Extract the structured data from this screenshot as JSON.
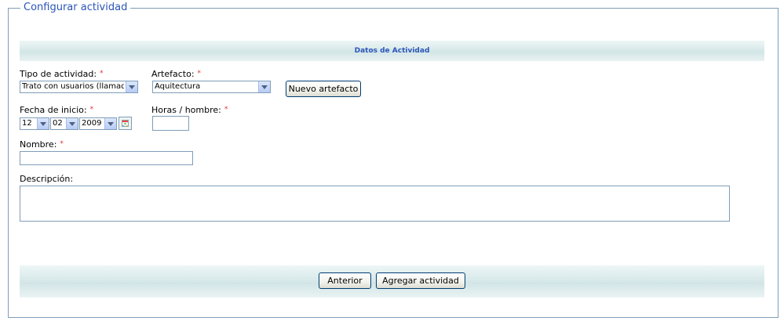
{
  "form": {
    "legend": "Configurar actividad",
    "section_title": "Datos de Actividad",
    "required_mark": "*"
  },
  "fields": {
    "tipo": {
      "label": "Tipo de actividad:",
      "value": "Trato con usuarios (llamadas"
    },
    "artefacto": {
      "label": "Artefacto:",
      "value": "Aquitectura"
    },
    "nuevo_artefacto": {
      "label": "Nuevo artefacto"
    },
    "fecha": {
      "label": "Fecha de inicio:",
      "day": "12",
      "month": "02",
      "year": "2009"
    },
    "horas": {
      "label": "Horas / hombre:",
      "value": ""
    },
    "nombre": {
      "label": "Nombre:",
      "value": ""
    },
    "descripcion": {
      "label": "Descripción:",
      "value": ""
    }
  },
  "footer": {
    "anterior_label": "Anterior",
    "agregar_label": "Agregar actividad"
  },
  "icons": {
    "calendar": "calendar-icon",
    "dropdown": "chevron-down-icon"
  }
}
